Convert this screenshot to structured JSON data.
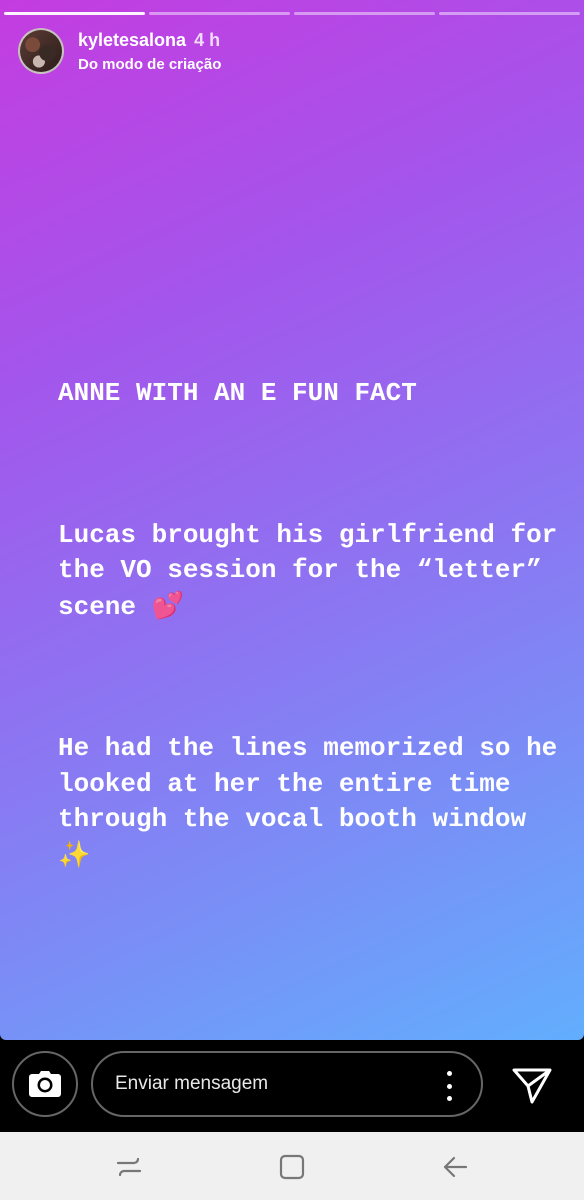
{
  "story": {
    "username": "kyletesalona",
    "time": "4 h",
    "subtitle": "Do modo de criação",
    "progress_segments": 4,
    "progress_done": 1,
    "title": "ANNE WITH AN E FUN FACT",
    "para1": "Lucas brought his girlfriend for the VO session for the “letter” scene",
    "emoji1": "💕",
    "para2": "He had the lines memorized so he looked at her the entire time through the vocal booth window",
    "emoji2": "✨",
    "gradient_colors": [
      "#c43ce0",
      "#a356ec",
      "#8a78f2",
      "#62aefd"
    ]
  },
  "reply": {
    "placeholder": "Enviar mensagem",
    "camera_icon": "camera-icon",
    "more_icon": "more-vertical-icon",
    "send_icon": "send-icon"
  },
  "nav": {
    "recent_icon": "recent-apps-icon",
    "home_icon": "home-icon",
    "back_icon": "back-icon"
  }
}
